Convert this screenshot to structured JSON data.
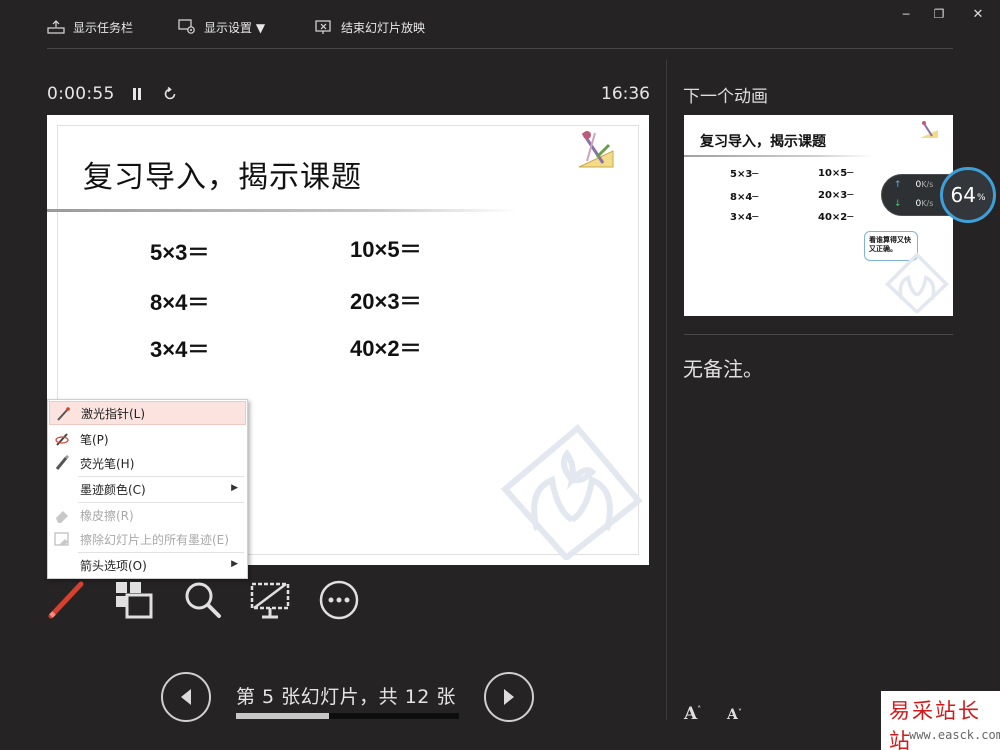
{
  "toolbar": {
    "taskbar_label": "显示任务栏",
    "display_settings_label": "显示设置 ▼",
    "end_show_label": "结束幻灯片放映"
  },
  "window": {
    "minimize": "─",
    "restore": "❐",
    "close": "✕"
  },
  "timer": {
    "elapsed": "0:00:55",
    "clock": "16:36"
  },
  "slide": {
    "title": "复习导入，揭示课题",
    "equations": [
      "5×3＝",
      "10×5＝",
      "8×4＝",
      "20×3＝",
      "3×4＝",
      "40×2＝"
    ]
  },
  "next_panel": {
    "label": "下一个动画",
    "thumb_title": "复习导入，揭示课题",
    "thumb_equations": [
      "5×3─",
      "10×5─",
      "8×4─",
      "20×3─",
      "3×4─",
      "40×2─"
    ],
    "bubble_text": "看谁算得又快又正确。"
  },
  "netmon": {
    "up_value": "0",
    "up_unit": "K/s",
    "down_value": "0",
    "down_unit": "K/s",
    "gauge_value": "64",
    "gauge_unit": "%"
  },
  "notes": {
    "text": "无备注。"
  },
  "menu": {
    "items": [
      {
        "label": "激光指针(L)",
        "icon": "laser-pointer-icon"
      },
      {
        "label": "笔(P)",
        "icon": "pen-icon"
      },
      {
        "label": "荧光笔(H)",
        "icon": "highlighter-icon"
      },
      {
        "label": "墨迹颜色(C)",
        "icon": ""
      },
      {
        "label": "橡皮擦(R)",
        "icon": "eraser-icon"
      },
      {
        "label": "擦除幻灯片上的所有墨迹(E)",
        "icon": "clear-ink-icon"
      },
      {
        "label": "箭头选项(O)",
        "icon": ""
      }
    ]
  },
  "navigation": {
    "slide_count": "第 5 张幻灯片，共 12 张",
    "current": 5,
    "total": 12
  },
  "font_controls": {
    "increase": "A",
    "decrease": "A"
  },
  "watermark": {
    "cn": "易采站长站",
    "url": "www.easck.com"
  },
  "colors": {
    "background": "#262324",
    "pen_accent": "#d6402e",
    "menu_highlight": "#fbe3e0",
    "gauge_ring": "#3ea0d8",
    "watermark_red": "#d11a1a"
  }
}
